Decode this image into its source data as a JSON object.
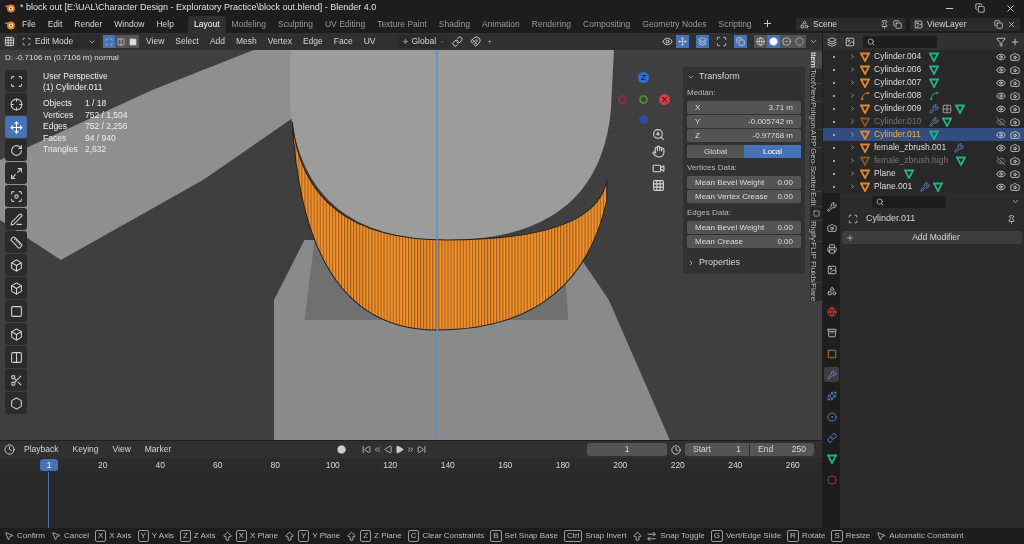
{
  "window": {
    "title": "* block out [E:\\UAL\\Character Design - Exploratory Practice\\block out.blend] - Blender 4.0"
  },
  "menu": [
    "File",
    "Edit",
    "Render",
    "Window",
    "Help"
  ],
  "workspaces": [
    {
      "label": "Layout",
      "selected": true
    },
    {
      "label": "Modeling",
      "selected": false
    },
    {
      "label": "Sculpting",
      "selected": false
    },
    {
      "label": "UV Editing",
      "selected": false
    },
    {
      "label": "Texture Paint",
      "selected": false
    },
    {
      "label": "Shading",
      "selected": false
    },
    {
      "label": "Animation",
      "selected": false
    },
    {
      "label": "Rendering",
      "selected": false
    },
    {
      "label": "Compositing",
      "selected": false
    },
    {
      "label": "Geometry Nodes",
      "selected": false
    },
    {
      "label": "Scripting",
      "selected": false
    }
  ],
  "scene": "Scene",
  "view_layer": "ViewLayer",
  "viewport_header": {
    "mode": "Edit Mode",
    "select_modes": [
      {
        "kind": "vertex",
        "selected": true
      },
      {
        "kind": "edge",
        "selected": false
      },
      {
        "kind": "face",
        "selected": false
      }
    ],
    "menus": [
      "View",
      "Select",
      "Add",
      "Mesh",
      "Vertex",
      "Edge",
      "Face",
      "UV"
    ],
    "orientation": "Global",
    "shading": [
      {
        "kind": "wireframe",
        "selected": false
      },
      {
        "kind": "solid",
        "selected": true
      },
      {
        "kind": "material",
        "selected": false
      },
      {
        "kind": "rendered",
        "selected": false
      }
    ]
  },
  "operator_info": "D: -0.7106 m (0.7106 m) normal",
  "overlay": {
    "view": "User Perspective",
    "object": "(1) Cylinder.011",
    "stats": [
      {
        "label": "Objects",
        "value": "1 / 18"
      },
      {
        "label": "Vertices",
        "value": "752 / 1,504"
      },
      {
        "label": "Edges",
        "value": "752 / 2,256"
      },
      {
        "label": "Faces",
        "value": "94 / 940"
      },
      {
        "label": "Triangles",
        "value": "2,632"
      }
    ]
  },
  "gizmo": {
    "z": "Z",
    "x": "X"
  },
  "tools": [
    {
      "kind": "select_box",
      "selected": false
    },
    {
      "kind": "cursor",
      "selected": false
    },
    {
      "kind": "move",
      "selected": true
    },
    {
      "kind": "rotate",
      "selected": false
    },
    {
      "kind": "scale",
      "selected": false
    },
    {
      "kind": "transform",
      "selected": false
    },
    {
      "kind": "annotate",
      "selected": false
    },
    {
      "kind": "measure",
      "selected": false
    },
    {
      "kind": "add_cube",
      "selected": false
    },
    {
      "kind": "extrude",
      "selected": false
    },
    {
      "kind": "inset",
      "selected": false
    },
    {
      "kind": "bevel",
      "selected": false
    },
    {
      "kind": "loop_cut",
      "selected": false
    },
    {
      "kind": "knife",
      "selected": false
    },
    {
      "kind": "poly_build",
      "selected": false
    }
  ],
  "n_panel": {
    "title": "Transform",
    "median_label": "Median:",
    "median": [
      {
        "label": "X",
        "value": "3.71 m"
      },
      {
        "label": "Y",
        "value": "-0.005742 m"
      },
      {
        "label": "Z",
        "value": "-0.97768 m"
      }
    ],
    "space": [
      {
        "label": "Global",
        "selected": false
      },
      {
        "label": "Local",
        "selected": true
      }
    ],
    "vertices_label": "Vertices Data:",
    "vertex_fields": [
      {
        "label": "Mean Bevel Weight",
        "value": "0.00"
      },
      {
        "label": "Mean Vertex Crease",
        "value": "0.00"
      }
    ],
    "edges_label": "Edges Data:",
    "edge_fields": [
      {
        "label": "Mean Bevel Weight",
        "value": "0.00"
      },
      {
        "label": "Mean Crease",
        "value": "0.00"
      }
    ],
    "properties": "Properties",
    "tabs": [
      {
        "kind": "text",
        "label": "Item",
        "selected": true
      },
      {
        "kind": "text",
        "label": "Tool",
        "selected": false
      },
      {
        "kind": "text",
        "label": "View",
        "selected": false
      },
      {
        "kind": "text",
        "label": "Poligon",
        "selected": false
      },
      {
        "kind": "text",
        "label": "ARP",
        "selected": false
      },
      {
        "kind": "text",
        "label": "Geo-Scatter",
        "selected": false
      },
      {
        "kind": "text",
        "label": "Edit",
        "selected": false
      },
      {
        "kind": "icon",
        "selected": false
      },
      {
        "kind": "text",
        "label": "Rigify",
        "selected": false
      },
      {
        "kind": "text",
        "label": "FLIP Fluids",
        "selected": false
      },
      {
        "kind": "text",
        "label": "Flare",
        "selected": false
      }
    ]
  },
  "outliner": {
    "rows": [
      {
        "name": "Cylinder.004",
        "kind": "mesh",
        "hidden": false,
        "selected": false,
        "extras": [
          {
            "kind": "mesh_data"
          }
        ]
      },
      {
        "name": "Cylinder.006",
        "kind": "mesh",
        "hidden": false,
        "selected": false,
        "extras": [
          {
            "kind": "mesh_data"
          }
        ]
      },
      {
        "name": "Cylinder.007",
        "kind": "mesh",
        "hidden": false,
        "selected": false,
        "extras": [
          {
            "kind": "mesh_data"
          }
        ]
      },
      {
        "name": "Cylinder.008",
        "kind": "curve",
        "hidden": false,
        "selected": false,
        "extras": [
          {
            "kind": "curve_data"
          }
        ]
      },
      {
        "name": "Cylinder.009",
        "kind": "mesh",
        "hidden": false,
        "selected": false,
        "extras": [
          {
            "kind": "modifier"
          },
          {
            "kind": "lattice"
          },
          {
            "kind": "mesh_data"
          }
        ]
      },
      {
        "name": "Cylinder.010",
        "kind": "mesh",
        "hidden": true,
        "selected": false,
        "extras": [
          {
            "kind": "modifier"
          },
          {
            "kind": "mesh_data"
          }
        ]
      },
      {
        "name": "Cylinder.011",
        "kind": "mesh",
        "hidden": false,
        "selected": true,
        "extras": [
          {
            "kind": "mesh_data"
          }
        ]
      },
      {
        "name": "female_zbrush.001",
        "kind": "mesh",
        "hidden": false,
        "selected": false,
        "extras": [
          {
            "kind": "modifier"
          }
        ]
      },
      {
        "name": "female_zbrush.high",
        "kind": "mesh",
        "hidden": true,
        "selected": false,
        "extras": [
          {
            "kind": "mesh_data"
          }
        ]
      },
      {
        "name": "Plane",
        "kind": "mesh",
        "hidden": false,
        "selected": false,
        "extras": [
          {
            "kind": "mesh_data"
          }
        ]
      },
      {
        "name": "Plane.001",
        "kind": "mesh",
        "hidden": false,
        "selected": false,
        "extras": [
          {
            "kind": "modifier"
          },
          {
            "kind": "mesh_data"
          }
        ]
      }
    ]
  },
  "properties": {
    "object": "Cylinder.011",
    "add_modifier": "Add Modifier",
    "tabs": [
      {
        "kind": "tool",
        "selected": false
      },
      {
        "kind": "render",
        "selected": false
      },
      {
        "kind": "output",
        "selected": false
      },
      {
        "kind": "view_layer",
        "selected": false
      },
      {
        "kind": "scene",
        "selected": false
      },
      {
        "kind": "world",
        "selected": false
      },
      {
        "kind": "collection",
        "selected": false
      },
      {
        "kind": "object",
        "selected": false
      },
      {
        "kind": "modifier",
        "selected": true
      },
      {
        "kind": "particles",
        "selected": false
      },
      {
        "kind": "physics",
        "selected": false
      },
      {
        "kind": "constraints",
        "selected": false
      },
      {
        "kind": "data",
        "selected": false
      },
      {
        "kind": "material",
        "selected": false
      }
    ]
  },
  "timeline": {
    "menus": [
      "Playback",
      "Keying",
      "View",
      "Marker"
    ],
    "current_frame": "1",
    "start_label": "Start",
    "start": "1",
    "end_label": "End",
    "end": "250",
    "playhead": "1",
    "ruler": [
      "20",
      "40",
      "60",
      "80",
      "100",
      "120",
      "140",
      "160",
      "180",
      "200",
      "220",
      "240",
      "260"
    ]
  },
  "status_bar": [
    {
      "label": "Confirm",
      "keys": [
        {
          "kind": "mouse"
        }
      ]
    },
    {
      "label": "Cancel",
      "keys": [
        {
          "kind": "mouse"
        }
      ]
    },
    {
      "label": "X Axis",
      "keys": [
        {
          "kind": "text",
          "text": "X"
        }
      ]
    },
    {
      "label": "Y Axis",
      "keys": [
        {
          "kind": "text",
          "text": "Y"
        }
      ]
    },
    {
      "label": "Z Axis",
      "keys": [
        {
          "kind": "text",
          "text": "Z"
        }
      ]
    },
    {
      "label": "X Plane",
      "keys": [
        {
          "kind": "shift"
        },
        {
          "kind": "text",
          "text": "X"
        }
      ]
    },
    {
      "label": "Y Plane",
      "keys": [
        {
          "kind": "shift"
        },
        {
          "kind": "text",
          "text": "Y"
        }
      ]
    },
    {
      "label": "Z Plane",
      "keys": [
        {
          "kind": "shift"
        },
        {
          "kind": "text",
          "text": "Z"
        }
      ]
    },
    {
      "label": "Clear Constraints",
      "keys": [
        {
          "kind": "text",
          "text": "C"
        }
      ]
    },
    {
      "label": "Set Snap Base",
      "keys": [
        {
          "kind": "text",
          "text": "B"
        }
      ]
    },
    {
      "label": "Snap Invert",
      "keys": [
        {
          "kind": "text",
          "text": "Ctrl"
        }
      ]
    },
    {
      "label": "Snap Toggle",
      "keys": [
        {
          "kind": "shift"
        },
        {
          "kind": "tab"
        }
      ]
    },
    {
      "label": "Vert/Edge Slide",
      "keys": [
        {
          "kind": "text",
          "text": "G"
        }
      ]
    },
    {
      "label": "Rotate",
      "keys": [
        {
          "kind": "text",
          "text": "R"
        }
      ]
    },
    {
      "label": "Resize",
      "keys": [
        {
          "kind": "text",
          "text": "S"
        }
      ]
    },
    {
      "label": "Automatic Constraint",
      "keys": [
        {
          "kind": "mouse"
        }
      ]
    }
  ]
}
